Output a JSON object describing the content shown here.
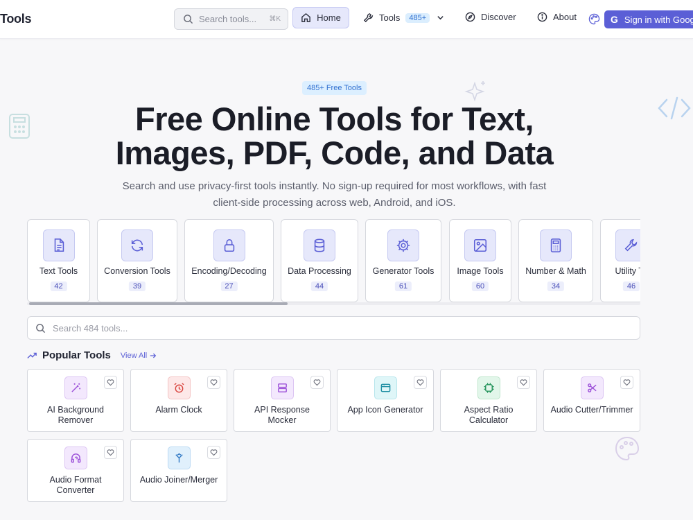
{
  "nav": {
    "brand": "Tools",
    "search_placeholder": "Search tools...",
    "search_shortcut": "⌘K",
    "home": "Home",
    "tools": "Tools",
    "tools_badge": "485+",
    "discover": "Discover",
    "about": "About",
    "signin": "Sign in with Goog"
  },
  "hero": {
    "badge": "485+ Free Tools",
    "title_line1": "Free Online Tools for Text,",
    "title_line2": "Images, PDF, Code, and Data",
    "subtitle_line1": "Search and use privacy-first tools instantly. No sign-up required for most workflows, with fast",
    "subtitle_line2": "client-side processing across web, Android, and iOS."
  },
  "categories": [
    {
      "label": "Text Tools",
      "count": "42",
      "icon": "file-text-icon"
    },
    {
      "label": "Conversion Tools",
      "count": "39",
      "icon": "refresh-icon"
    },
    {
      "label": "Encoding/Decoding",
      "count": "27",
      "icon": "lock-icon"
    },
    {
      "label": "Data Processing",
      "count": "44",
      "icon": "database-icon"
    },
    {
      "label": "Generator Tools",
      "count": "61",
      "icon": "gear-icon"
    },
    {
      "label": "Image Tools",
      "count": "60",
      "icon": "image-icon"
    },
    {
      "label": "Number & Math",
      "count": "34",
      "icon": "calculator-icon"
    },
    {
      "label": "Utility To",
      "count": "46",
      "icon": "wrench-icon"
    }
  ],
  "main_search": {
    "placeholder": "Search 484 tools..."
  },
  "popular": {
    "title": "Popular Tools",
    "view_all": "View All",
    "tools": [
      {
        "name_line1": "AI Background",
        "name_line2": "Remover",
        "icon": "magic-wand-icon",
        "color": "#f3e8fd"
      },
      {
        "name_line1": "Alarm Clock",
        "name_line2": "",
        "icon": "alarm-clock-icon",
        "color": "#fde8e8"
      },
      {
        "name_line1": "API Response",
        "name_line2": "Mocker",
        "icon": "server-icon",
        "color": "#f3e8fd"
      },
      {
        "name_line1": "App Icon Generator",
        "name_line2": "",
        "icon": "app-window-icon",
        "color": "#dff6f8"
      },
      {
        "name_line1": "Aspect Ratio",
        "name_line2": "Calculator",
        "icon": "aspect-ratio-icon",
        "color": "#e2f6ea"
      },
      {
        "name_line1": "Audio Cutter/Trimmer",
        "name_line2": "",
        "icon": "scissors-icon",
        "color": "#f3e8fd"
      },
      {
        "name_line1": "Audio Format",
        "name_line2": "Converter",
        "icon": "headphones-icon",
        "color": "#f3e8fd"
      },
      {
        "name_line1": "Audio Joiner/Merger",
        "name_line2": "",
        "icon": "merge-icon",
        "color": "#e0f0fc"
      }
    ]
  },
  "colors": {
    "accent": "#5b5fd6",
    "badge_blue": "#2f6fd0"
  }
}
